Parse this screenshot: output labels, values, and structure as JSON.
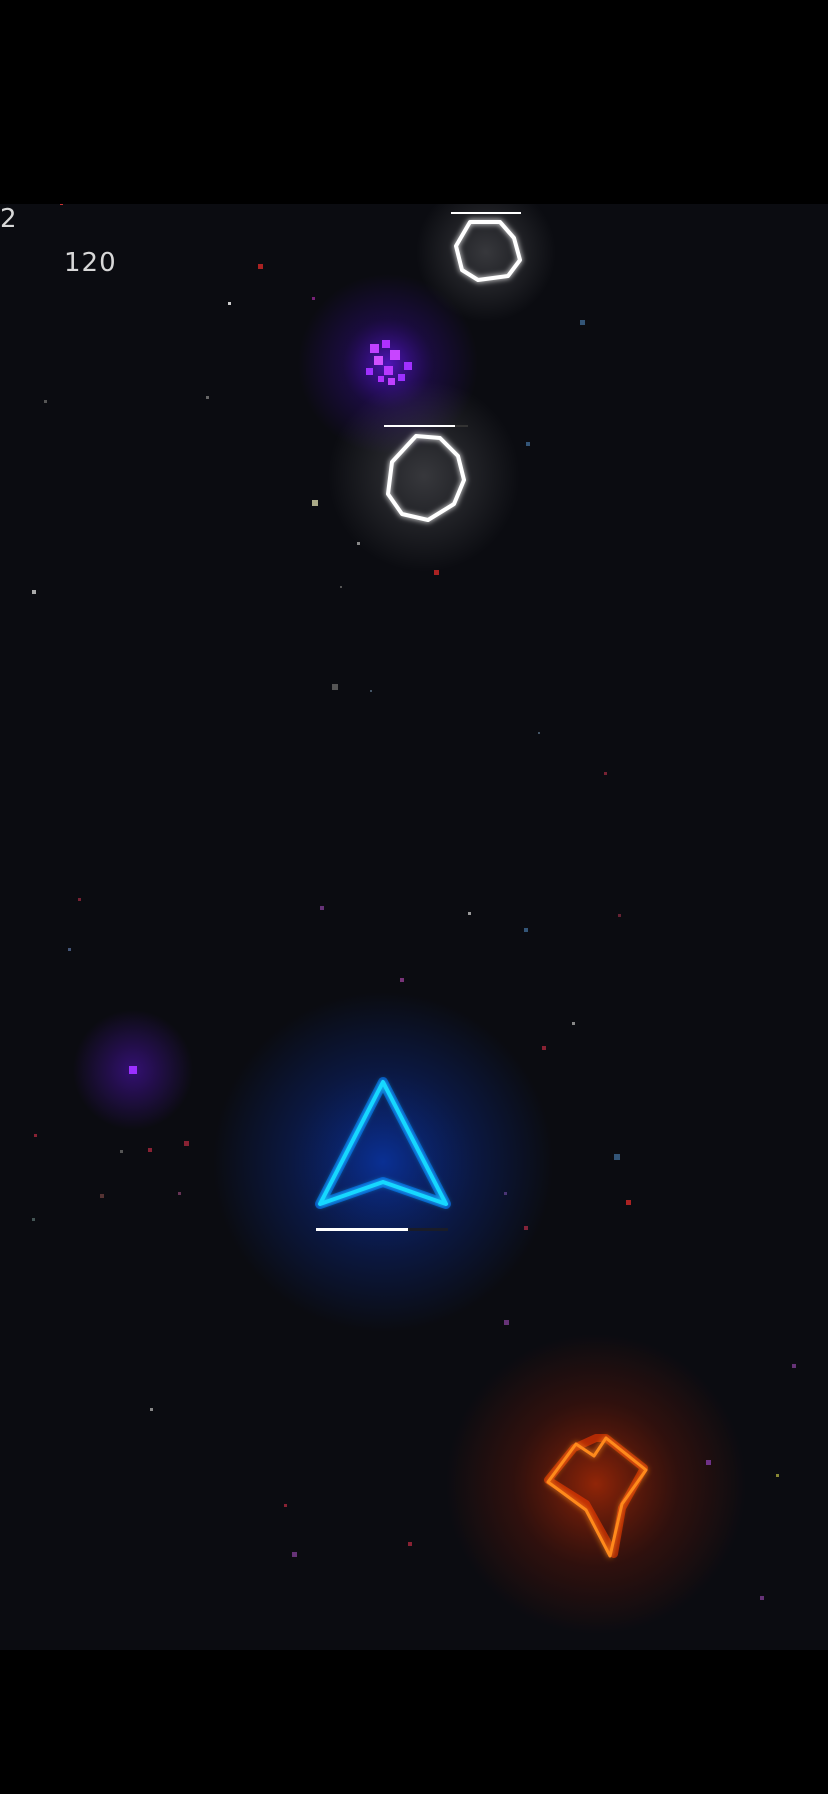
{
  "hud": {
    "lives": "2",
    "score": "120"
  },
  "colors": {
    "background": "#0b0c11",
    "player_ship": "#19d8ff",
    "player_glow": "#0a4dff",
    "asteroid": "#ffffff",
    "enemy_ship": "#ff8a1a",
    "enemy_glow": "#ff3a00",
    "explosion": "#b43cff",
    "powerup": "#9b30ff"
  },
  "entities": {
    "player": {
      "icon": "arrowhead-ship-icon",
      "health_fraction": 0.7
    },
    "asteroids": [
      {
        "icon": "asteroid-outline-icon",
        "health_fraction": 1.0
      },
      {
        "icon": "asteroid-outline-icon",
        "health_fraction": 0.85
      }
    ],
    "enemy": {
      "icon": "enemy-ship-icon"
    },
    "explosion": {
      "icon": "particle-burst-icon"
    },
    "pickup": {
      "icon": "purple-particle-icon"
    }
  }
}
